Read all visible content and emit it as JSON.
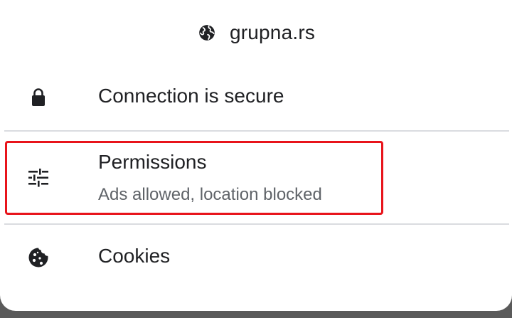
{
  "header": {
    "domain": "grupna.rs",
    "icon": "globe-icon"
  },
  "items": [
    {
      "title": "Connection is secure",
      "icon": "lock-icon"
    },
    {
      "title": "Permissions",
      "subtitle": "Ads allowed, location blocked",
      "icon": "tune-icon"
    },
    {
      "title": "Cookies",
      "icon": "cookie-icon"
    }
  ],
  "colors": {
    "text_primary": "#202124",
    "text_secondary": "#5f6368",
    "divider": "#dadce0",
    "highlight": "#e8141b"
  }
}
